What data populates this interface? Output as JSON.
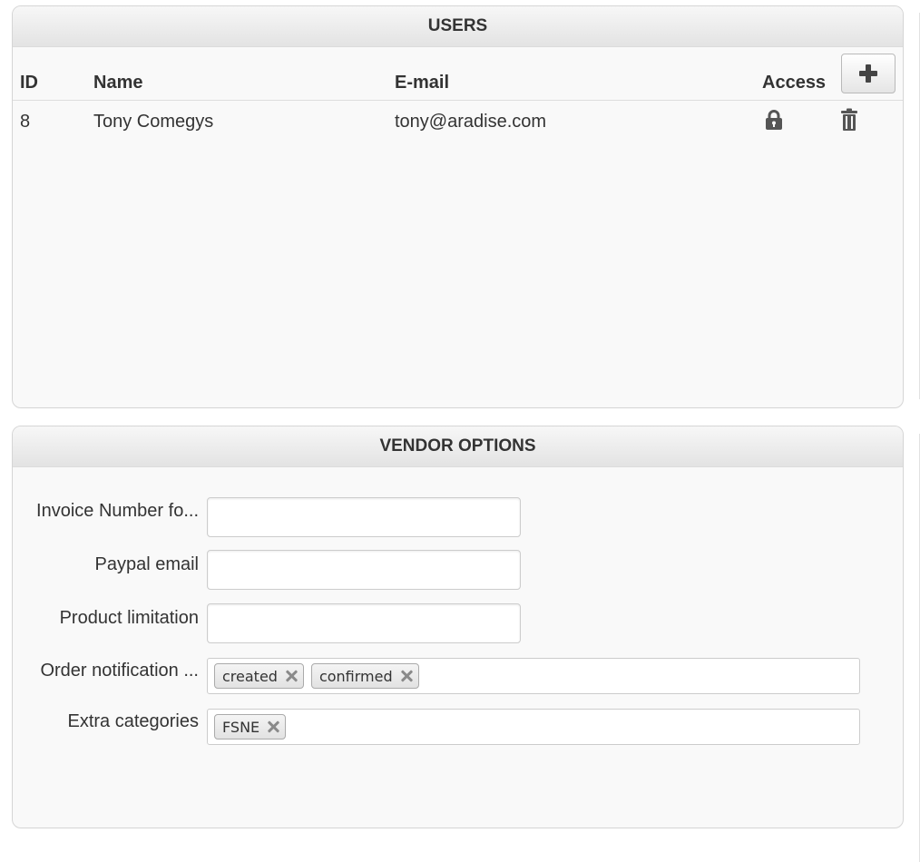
{
  "users_panel": {
    "title": "USERS",
    "columns": {
      "id": "ID",
      "name": "Name",
      "email": "E-mail",
      "access": "Access"
    },
    "add_button_icon": "plus-icon",
    "rows": [
      {
        "id": "8",
        "name": "Tony Comegys",
        "email": "tony@aradise.com",
        "access_icon": "lock-icon",
        "delete_icon": "trash-icon"
      }
    ]
  },
  "vendor_panel": {
    "title": "VENDOR OPTIONS",
    "fields": {
      "invoice_number": {
        "label": "Invoice Number fo...",
        "value": ""
      },
      "paypal_email": {
        "label": "Paypal email",
        "value": ""
      },
      "product_limitation": {
        "label": "Product limitation",
        "value": ""
      },
      "order_notification": {
        "label": "Order notification ...",
        "tags": [
          "created",
          "confirmed"
        ]
      },
      "extra_categories": {
        "label": "Extra categories",
        "tags": [
          "FSNE"
        ]
      }
    }
  },
  "colors": {
    "panel_bg": "#f9f9f9",
    "header_bg_top": "#f7f7f7",
    "header_bg_bottom": "#e3e3e3",
    "border": "#d5d5d5",
    "text": "#333333",
    "icon": "#555555",
    "tag_remove": "#8a8a8a"
  }
}
